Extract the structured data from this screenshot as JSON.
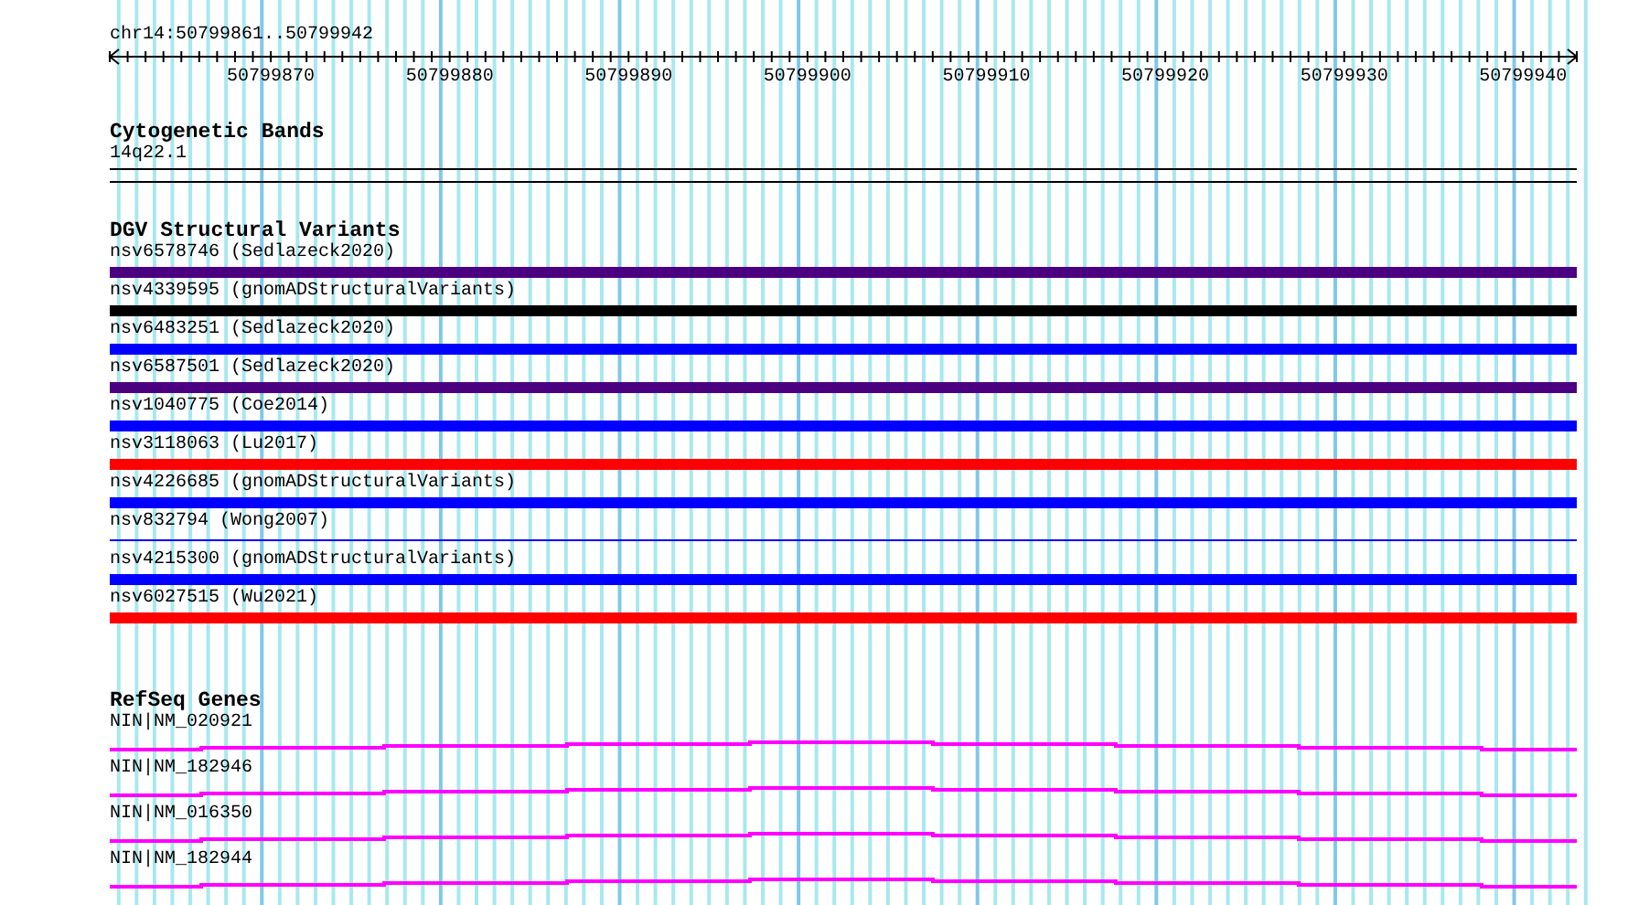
{
  "ruler": {
    "location": "chr14:50799861..50799942",
    "ticks": [
      "50799870",
      "50799880",
      "50799890",
      "50799900",
      "50799910",
      "50799920",
      "50799930",
      "50799940"
    ]
  },
  "cytogenetic_bands": {
    "title": "Cytogenetic Bands",
    "bands": [
      {
        "label": "14q22.1"
      }
    ]
  },
  "dgv_structural_variants": {
    "title": "DGV Structural Variants",
    "features": [
      {
        "label": "nsv6578746 (Sedlazeck2020)",
        "color": "#4b0082",
        "kind": "bar"
      },
      {
        "label": "nsv4339595 (gnomADStructuralVariants)",
        "color": "#000000",
        "kind": "bar"
      },
      {
        "label": "nsv6483251 (Sedlazeck2020)",
        "color": "#0000ff",
        "kind": "bar"
      },
      {
        "label": "nsv6587501 (Sedlazeck2020)",
        "color": "#4b0082",
        "kind": "bar"
      },
      {
        "label": "nsv1040775 (Coe2014)",
        "color": "#0000ff",
        "kind": "bar"
      },
      {
        "label": "nsv3118063 (Lu2017)",
        "color": "#ff0000",
        "kind": "bar"
      },
      {
        "label": "nsv4226685 (gnomADStructuralVariants)",
        "color": "#0000ff",
        "kind": "bar"
      },
      {
        "label": "nsv832794 (Wong2007)",
        "color": "#0000ff",
        "kind": "line"
      },
      {
        "label": "nsv4215300 (gnomADStructuralVariants)",
        "color": "#0000ff",
        "kind": "bar"
      },
      {
        "label": "nsv6027515 (Wu2021)",
        "color": "#ff0000",
        "kind": "bar"
      }
    ]
  },
  "refseq_genes": {
    "title": "RefSeq Genes",
    "features": [
      {
        "label": "NIN|NM_020921"
      },
      {
        "label": "NIN|NM_182946"
      },
      {
        "label": "NIN|NM_016350"
      },
      {
        "label": "NIN|NM_182944"
      }
    ]
  }
}
